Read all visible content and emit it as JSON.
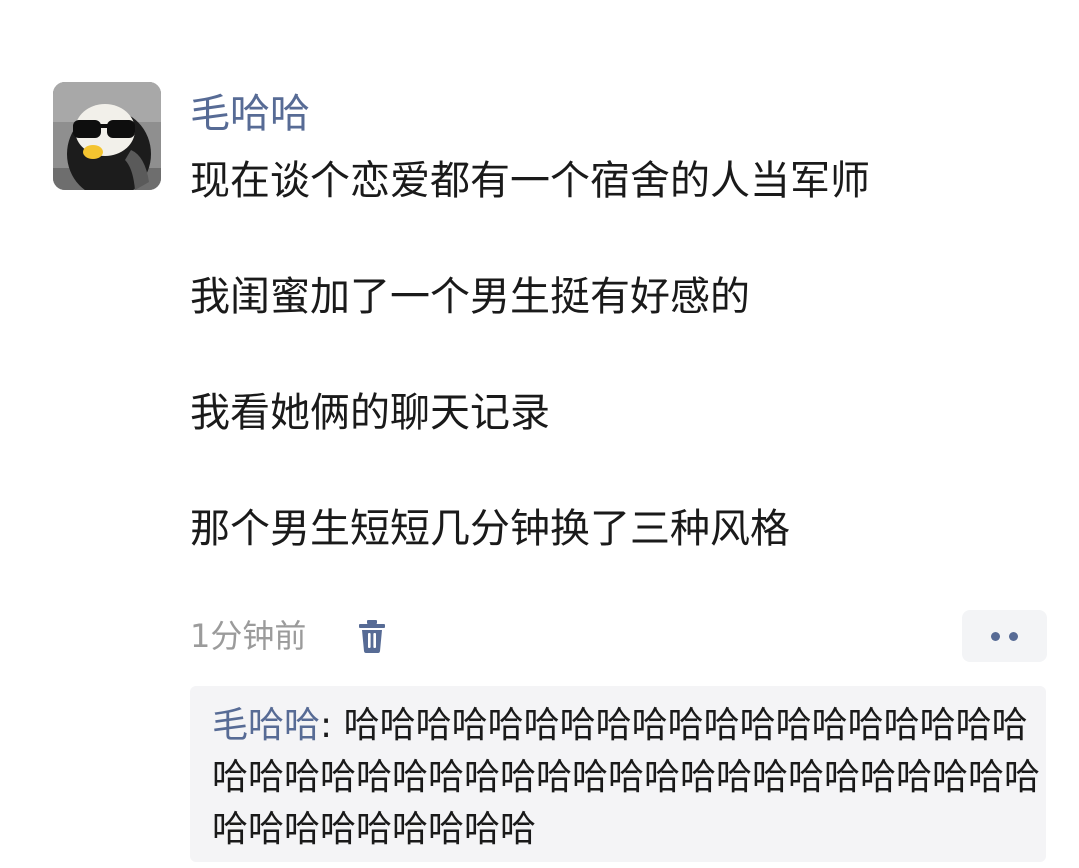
{
  "post": {
    "author": "毛哈哈",
    "lines": [
      "现在谈个恋爱都有一个宿舍的人当军师",
      "我闺蜜加了一个男生挺有好感的",
      "我看她俩的聊天记录",
      "那个男生短短几分钟换了三种风格"
    ],
    "timestamp": "1分钟前",
    "delete_icon": "trash-icon",
    "more_icon": "more-dots-icon"
  },
  "comments": [
    {
      "author": "毛哈哈",
      "separator": ": ",
      "text": "哈哈哈哈哈哈哈哈哈哈哈哈哈哈哈哈哈哈哈哈哈哈哈哈哈哈哈哈哈哈哈哈哈哈哈哈哈哈哈哈哈哈哈哈哈哈哈哈哈哈哈"
    }
  ],
  "colors": {
    "link": "#576b95",
    "text": "#1a1a1a",
    "muted": "#9b9b9b",
    "comment_bg": "#f4f4f6"
  }
}
